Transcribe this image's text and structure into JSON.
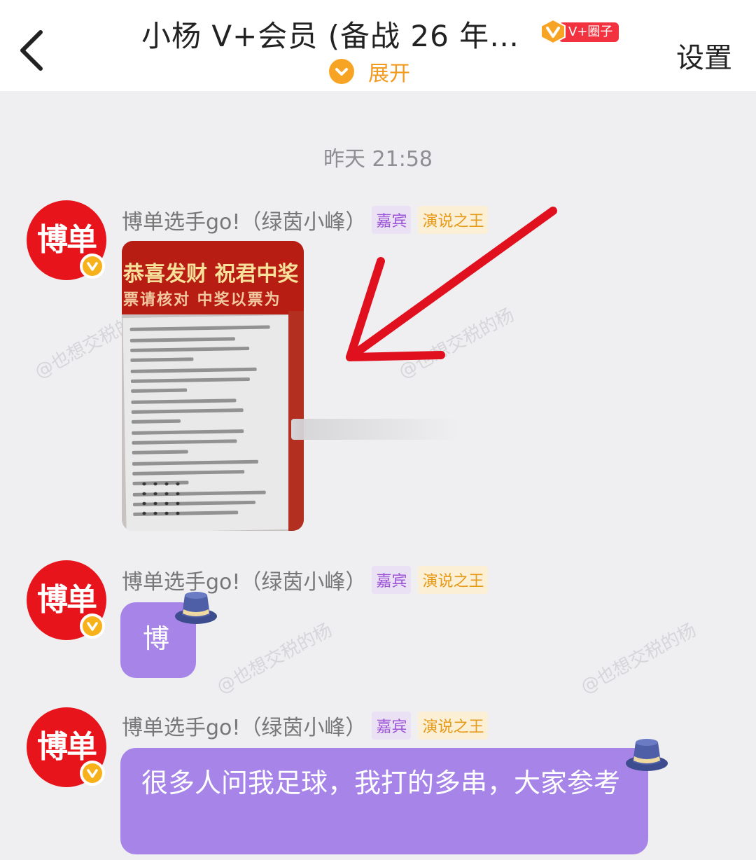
{
  "header": {
    "title": "小杨 V+会员 (备战 26 年…",
    "vplus_tag": "V+圈子",
    "expand_label": "展开",
    "settings_label": "设置"
  },
  "timestamp": "昨天 21:58",
  "avatar_text": "博单",
  "messages": [
    {
      "sender": "博单选手go!（绿茵小峰）",
      "role_badge": "嘉宾",
      "title_badge": "演说之王",
      "type": "image",
      "image_lines": [
        "恭喜发财  祝君中奖",
        "票请核对  中奖以票为"
      ]
    },
    {
      "sender": "博单选手go!（绿茵小峰）",
      "role_badge": "嘉宾",
      "title_badge": "演说之王",
      "type": "text",
      "text": "博"
    },
    {
      "sender": "博单选手go!（绿茵小峰）",
      "role_badge": "嘉宾",
      "title_badge": "演说之王",
      "type": "text",
      "text": "很多人问我足球，我打的多串，大家参考"
    }
  ],
  "watermark": "@也想交税的杨",
  "colors": {
    "bubble": "#a684e8",
    "accent_orange": "#f7a424",
    "avatar_red": "#e8141b",
    "annotation_arrow": "#e0101e"
  }
}
